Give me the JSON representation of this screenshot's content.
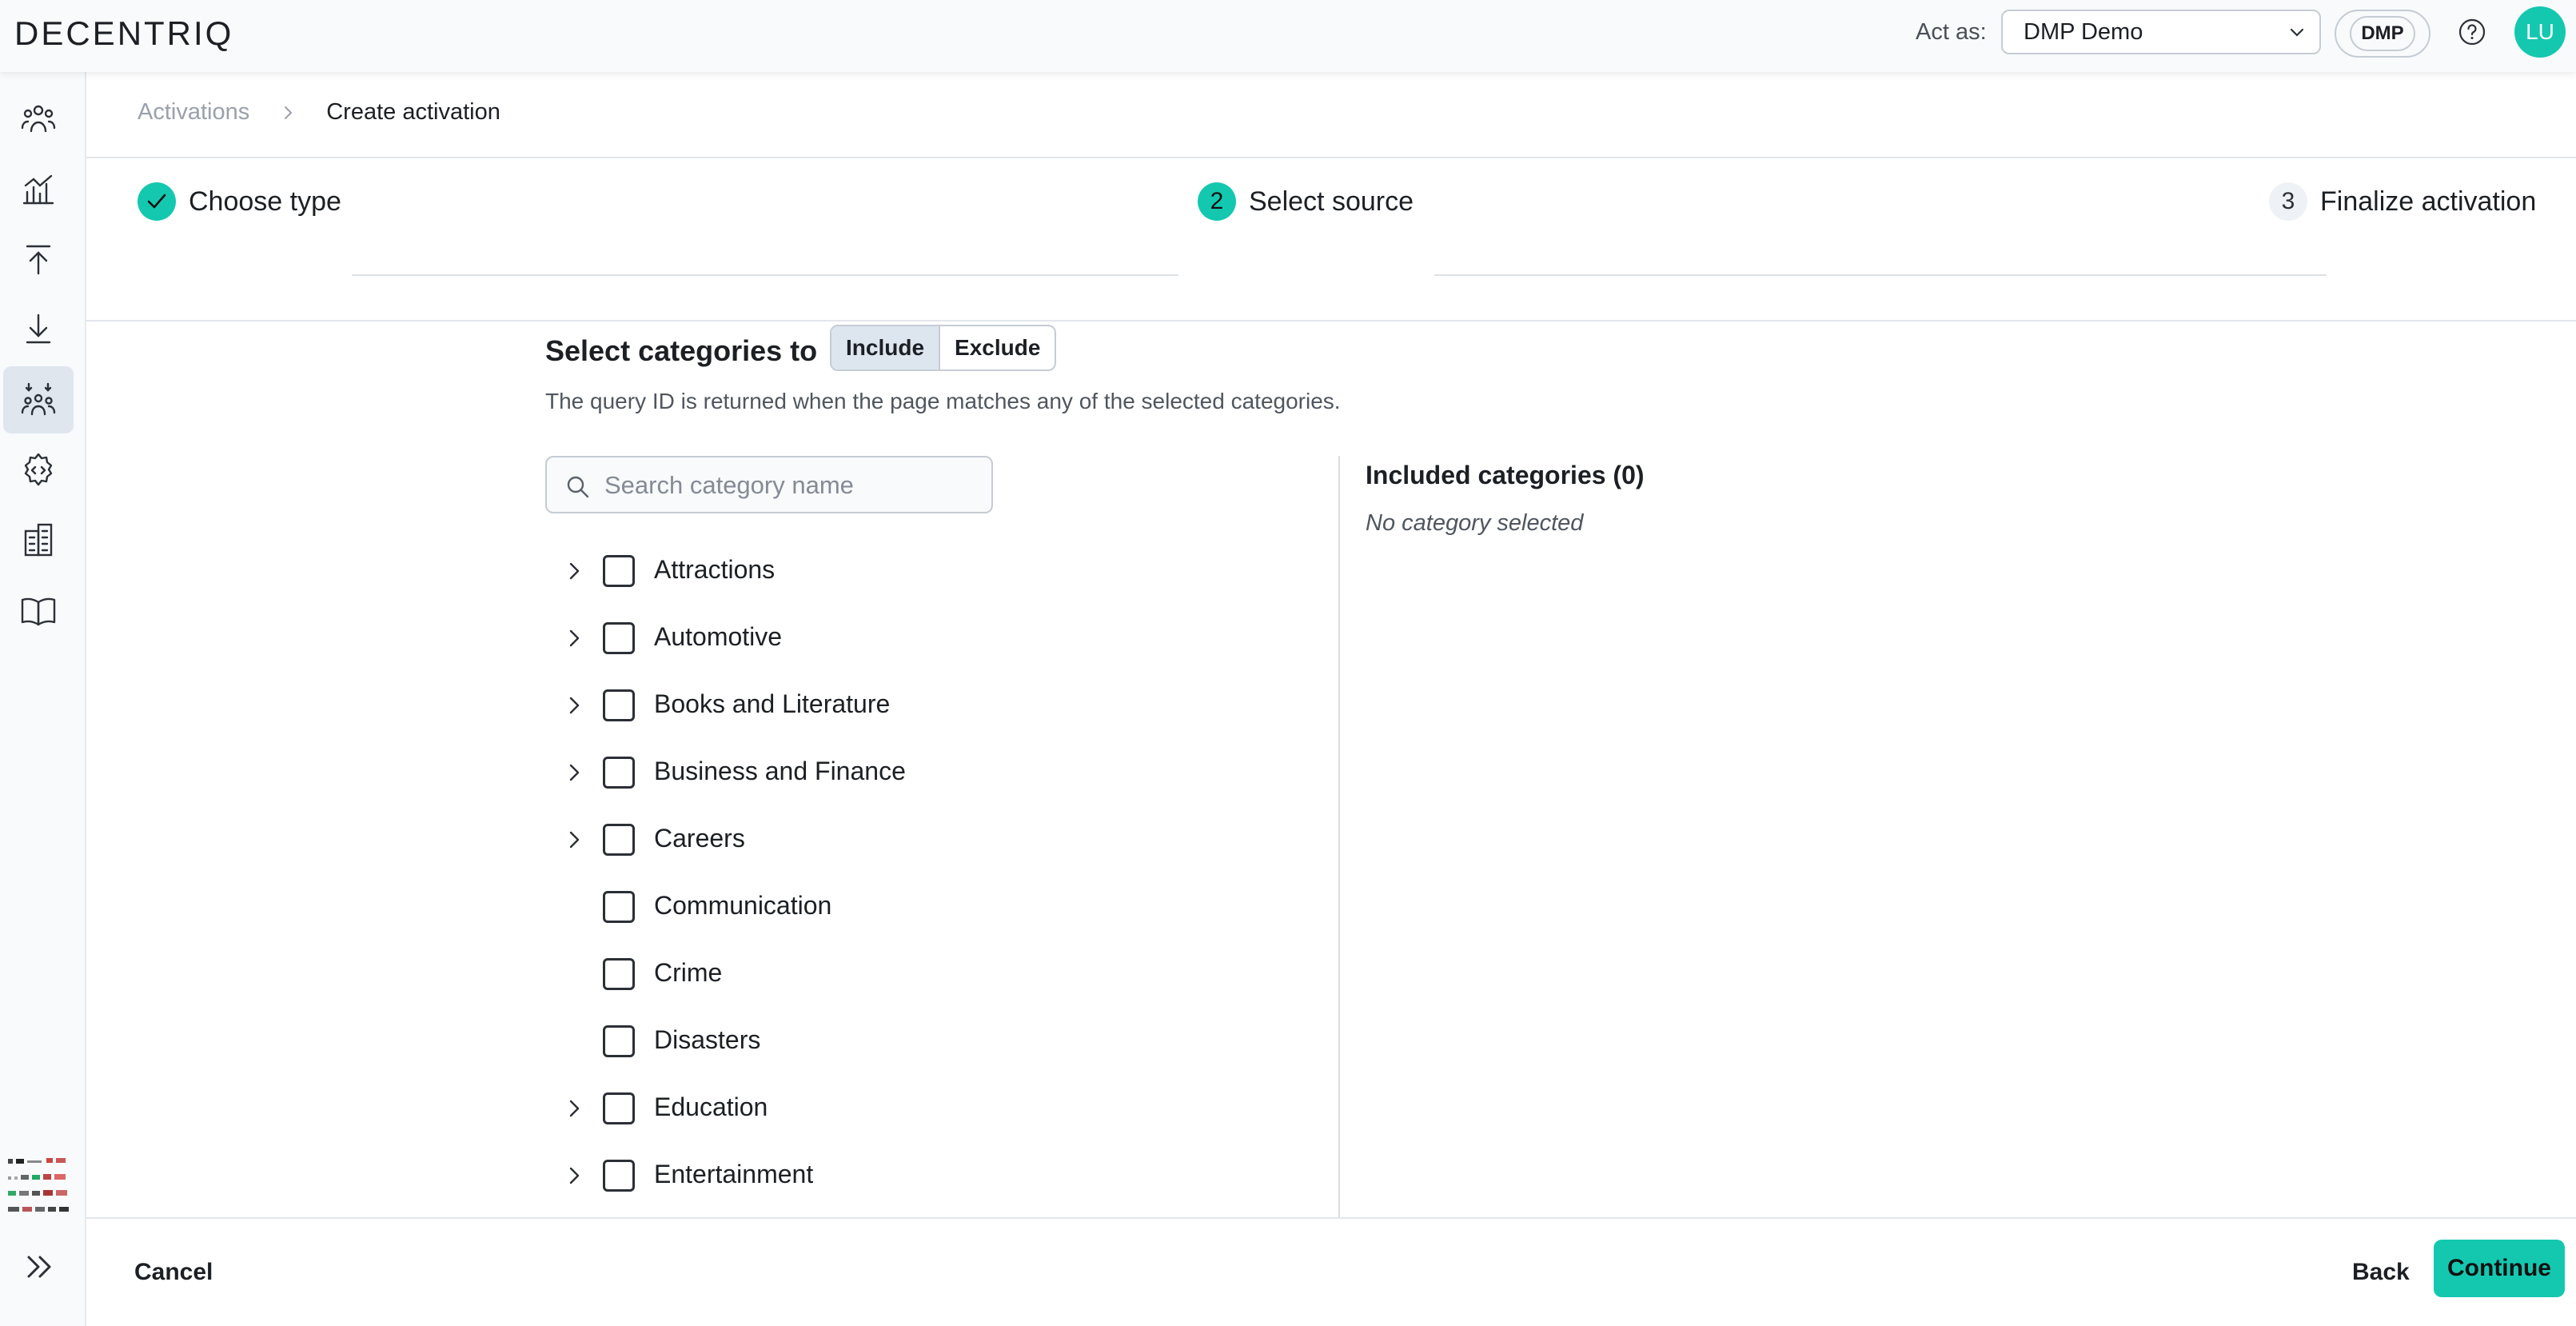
{
  "app": {
    "logo": "DECENTRIQ"
  },
  "header": {
    "act_as_label": "Act as:",
    "act_as_value": "DMP Demo",
    "org_chip": "DMP",
    "avatar_initials": "LU"
  },
  "sidebar": {
    "icons": [
      "people-icon",
      "analytics-icon",
      "upload-icon",
      "download-icon",
      "audience-icon",
      "code-gear-icon",
      "building-icon",
      "book-icon"
    ],
    "active_index": 4
  },
  "breadcrumb": {
    "parent": "Activations",
    "current": "Create activation"
  },
  "stepper": {
    "steps": [
      {
        "number": "1",
        "label": "Choose type",
        "state": "done"
      },
      {
        "number": "2",
        "label": "Select source",
        "state": "current"
      },
      {
        "number": "3",
        "label": "Finalize activation",
        "state": "future"
      }
    ]
  },
  "section": {
    "title": "Select categories to",
    "toggle_include": "Include",
    "toggle_exclude": "Exclude",
    "selected_mode": "Include",
    "subtitle": "The query ID is returned when the page matches any of the selected categories."
  },
  "search": {
    "placeholder": "Search category name",
    "value": ""
  },
  "categories": [
    {
      "label": "Attractions",
      "expandable": true
    },
    {
      "label": "Automotive",
      "expandable": true
    },
    {
      "label": "Books and Literature",
      "expandable": true
    },
    {
      "label": "Business and Finance",
      "expandable": true
    },
    {
      "label": "Careers",
      "expandable": true
    },
    {
      "label": "Communication",
      "expandable": false
    },
    {
      "label": "Crime",
      "expandable": false
    },
    {
      "label": "Disasters",
      "expandable": false
    },
    {
      "label": "Education",
      "expandable": true
    },
    {
      "label": "Entertainment",
      "expandable": true
    }
  ],
  "included": {
    "title": "Included categories (0)",
    "empty_text": "No category selected"
  },
  "footer": {
    "cancel": "Cancel",
    "back": "Back",
    "continue": "Continue"
  },
  "colors": {
    "accent": "#14c8b0",
    "text": "#1c1f24",
    "muted": "#9aa1ab"
  }
}
